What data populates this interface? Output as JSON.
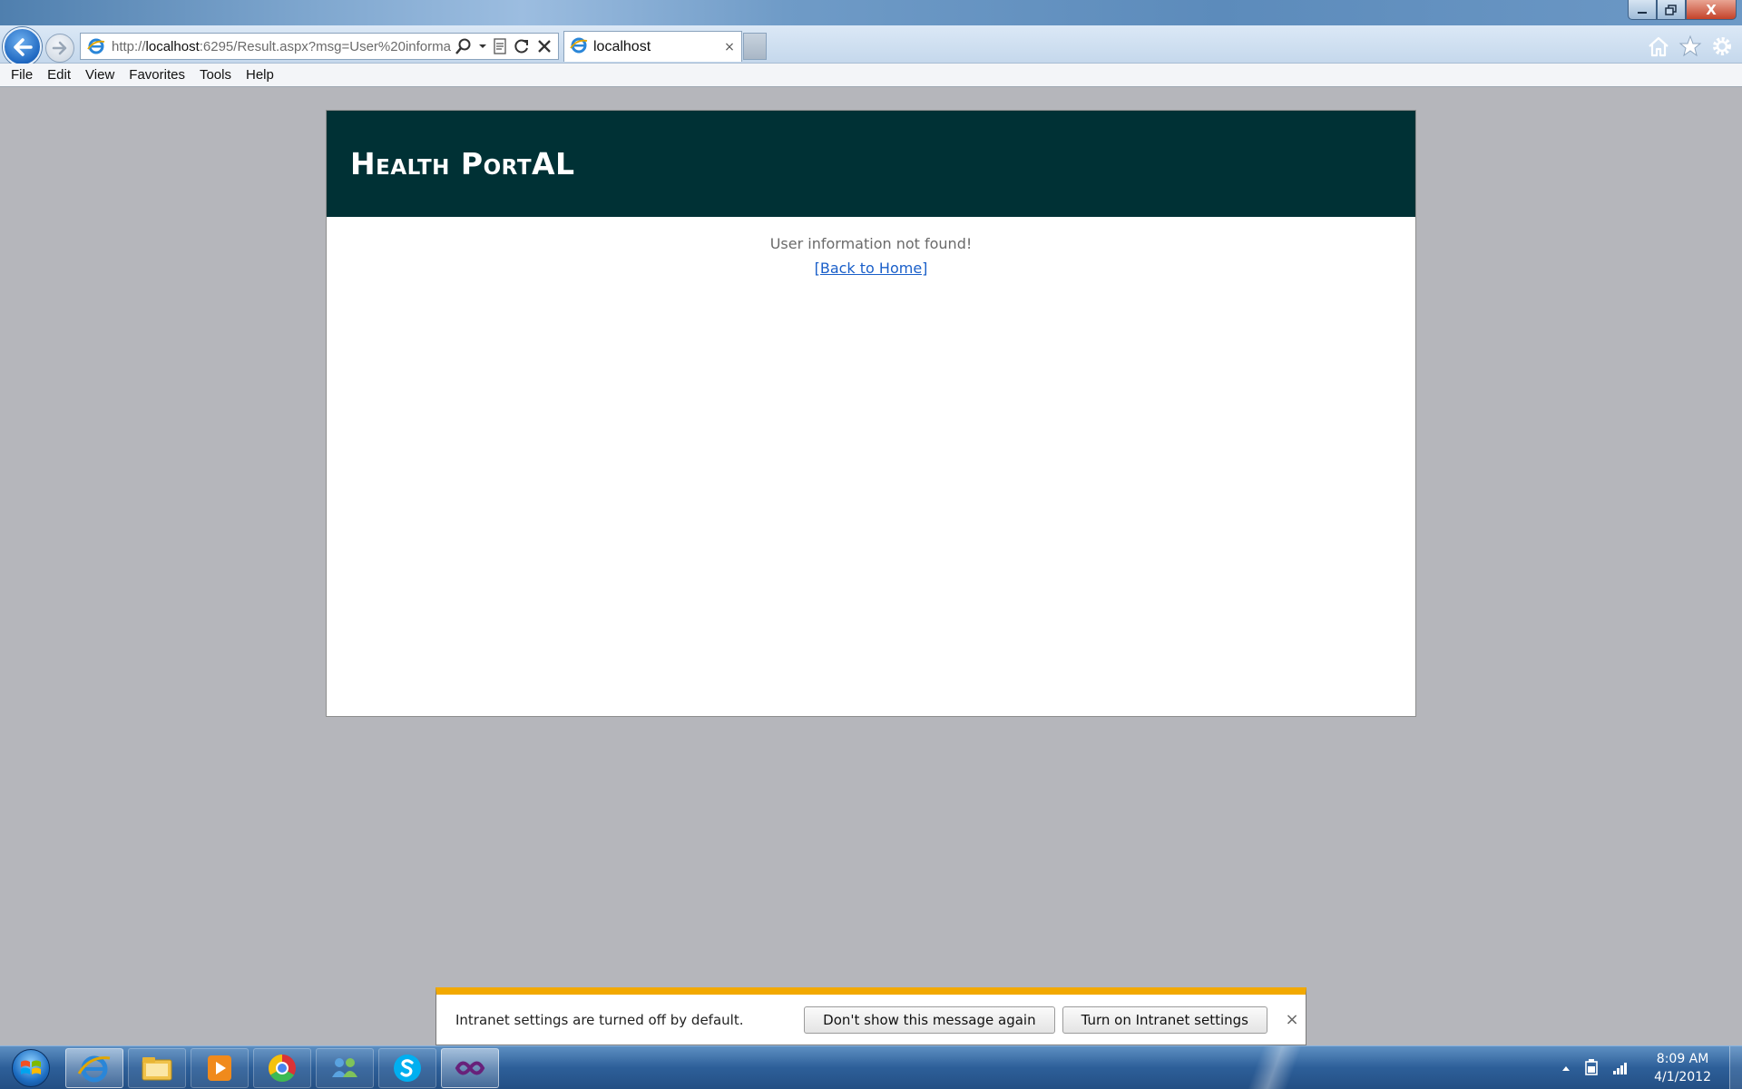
{
  "window": {
    "minimize_icon": "minimize-icon",
    "maximize_icon": "restore-icon",
    "close_label": "X"
  },
  "browser": {
    "address": {
      "prefix": "http://",
      "host": "localhost",
      "rest": ":6295/Result.aspx?msg=User%20informa"
    },
    "tab": {
      "title": "localhost",
      "close": "×"
    }
  },
  "menu": {
    "items": [
      "File",
      "Edit",
      "View",
      "Favorites",
      "Tools",
      "Help"
    ]
  },
  "page": {
    "site_title": "Health PortAL",
    "message": "User information not found!",
    "back_link": "[Back to Home]",
    "header_color": "#003135",
    "link_color": "#1a5fc9"
  },
  "notification": {
    "text": "Intranet settings are turned off by default.",
    "button_dismiss": "Don't show this message again",
    "button_enable": "Turn on Intranet settings",
    "close": "×",
    "accent_color": "#f2a900"
  },
  "taskbar": {
    "apps": [
      "internet-explorer",
      "file-explorer",
      "media-player",
      "chrome",
      "messenger",
      "skype",
      "visual-studio"
    ],
    "clock": {
      "time": "8:09 AM",
      "date": "4/1/2012"
    }
  }
}
